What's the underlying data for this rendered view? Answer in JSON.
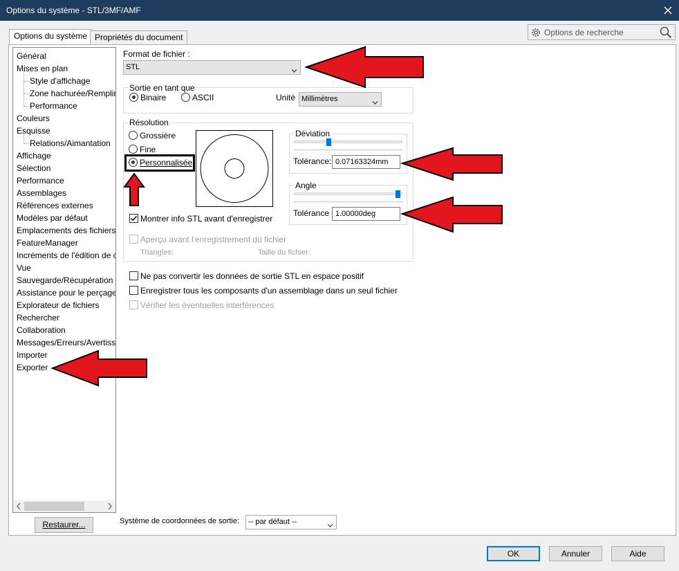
{
  "window": {
    "title": "Options du système - STL/3MF/AMF"
  },
  "tabs": {
    "system": "Options du système",
    "document": "Propriétés du document"
  },
  "search": {
    "placeholder": "Options de recherche"
  },
  "tree": {
    "items": [
      {
        "label": "Général"
      },
      {
        "label": "Mises en plan"
      },
      {
        "label": "Style d'affichage"
      },
      {
        "label": "Zone hachurée/Remplir"
      },
      {
        "label": "Performance"
      },
      {
        "label": "Couleurs"
      },
      {
        "label": "Esquisse"
      },
      {
        "label": "Relations/Aimantation"
      },
      {
        "label": "Affichage"
      },
      {
        "label": "Sélection"
      },
      {
        "label": "Performance"
      },
      {
        "label": "Assemblages"
      },
      {
        "label": "Références externes"
      },
      {
        "label": "Modèles par défaut"
      },
      {
        "label": "Emplacements des fichiers"
      },
      {
        "label": "FeatureManager"
      },
      {
        "label": "Incréments de l'édition de c"
      },
      {
        "label": "Vue"
      },
      {
        "label": "Sauvegarde/Récupération"
      },
      {
        "label": "Assistance pour le perçage/"
      },
      {
        "label": "Explorateur de fichiers"
      },
      {
        "label": "Rechercher"
      },
      {
        "label": "Collaboration"
      },
      {
        "label": "Messages/Erreurs/Avertisse"
      },
      {
        "label": "Importer"
      },
      {
        "label": "Exporter"
      }
    ]
  },
  "restore_label": "Restaurer...",
  "format": {
    "label": "Format de fichier :",
    "value": "STL"
  },
  "output": {
    "group_label": "Sortie en tant que",
    "binary": "Binaire",
    "ascii": "ASCII",
    "unit_label": "Unité",
    "unit_value": "Millimètres"
  },
  "resolution": {
    "group_label": "Résolution",
    "coarse": "Grossière",
    "fine": "Fine",
    "custom": "Personnalisée",
    "deviation_label": "Déviation",
    "deviation_tol_label": "Tolérance:",
    "deviation_tol_value": "0.07163324mm",
    "angle_label": "Angle",
    "angle_tol_label": "Tolérance",
    "angle_tol_value": "1.00000deg",
    "show_info": "Montrer info STL avant d'enregistrer",
    "preview": "Aperçu avant l'enregistrement du fichier",
    "triangles": "Triangles:",
    "filesize": "Taille du fichier:"
  },
  "options": {
    "no_convert": "Ne pas convertir les données de sortie STL en espace positif",
    "save_all": "Enregistrer tous les composants d'un assemblage dans un seul fichier",
    "check_interf": "Vérifier les éventuelles interférences"
  },
  "coord": {
    "label": "Système de coordonnées de sortie:",
    "value": "-- par défaut --"
  },
  "buttons": {
    "ok": "OK",
    "cancel": "Annuler",
    "help": "Aide"
  },
  "colors": {
    "arrow": "#e3161e",
    "titlebar": "#1f3c5c",
    "accent": "#0078d7"
  }
}
